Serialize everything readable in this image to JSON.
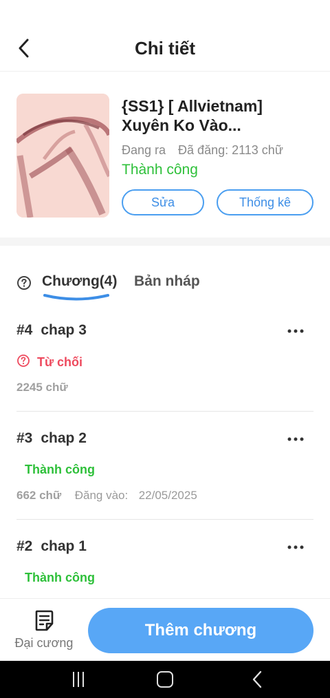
{
  "header": {
    "title": "Chi tiết"
  },
  "story": {
    "title": "{SS1} [ Allvietnam] Xuyên Ko Vào...",
    "state": "Đang ra",
    "published": "Đã đăng: 2113 chữ",
    "status": "Thành công",
    "edit_label": "Sửa",
    "stats_label": "Thống kê"
  },
  "tabs": {
    "chapters_label": "Chương(4)",
    "drafts_label": "Bản nháp"
  },
  "chapters": [
    {
      "num": "#4",
      "title": "chap 3",
      "status": "Từ chối",
      "words": "2245 chữ",
      "date_label": "",
      "date": ""
    },
    {
      "num": "#3",
      "title": "chap 2",
      "status": "Thành công",
      "words": "662 chữ",
      "date_label": "Đăng vào:",
      "date": "22/05/2025"
    },
    {
      "num": "#2",
      "title": "chap 1",
      "status": "Thành công"
    }
  ],
  "bottom": {
    "outline_label": "Đại cương",
    "add_chapter_label": "Thêm chương"
  },
  "colors": {
    "accent": "#58a7f6",
    "success": "#2ec03a",
    "rejected": "#ee4a5e",
    "outline_border": "#4a9ef0"
  },
  "icons": [
    "back-arrow-icon",
    "help-circle-icon",
    "more-dots-icon",
    "document-icon",
    "recent-apps-icon",
    "home-icon",
    "nav-back-icon"
  ]
}
